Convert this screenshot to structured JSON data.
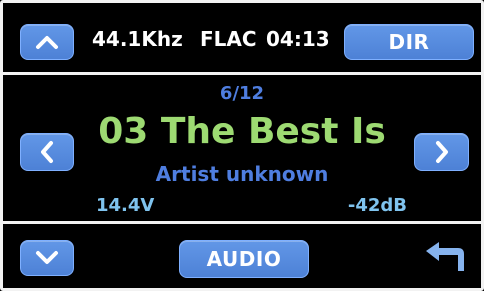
{
  "status_bar": {
    "sample_rate": "44.1Khz",
    "format": "FLAC",
    "time": "04:13",
    "dir_button_label": "DIR"
  },
  "now_playing": {
    "track_position": "6/12",
    "track_title": "03 The Best Is",
    "artist": "Artist unknown",
    "voltage": "14.4V",
    "volume": "-42dB"
  },
  "bottom_bar": {
    "audio_button_label": "AUDIO"
  },
  "icons": {
    "up": "chevron-up-icon",
    "down": "chevron-down-icon",
    "prev": "chevron-left-icon",
    "next": "chevron-right-icon",
    "back": "return-arrow-icon"
  },
  "colors": {
    "button_blue": "#5a8ee3",
    "title_green": "#9dda72",
    "accent_blue": "#4f7ee0",
    "info_cyan": "#7fc3ee"
  }
}
